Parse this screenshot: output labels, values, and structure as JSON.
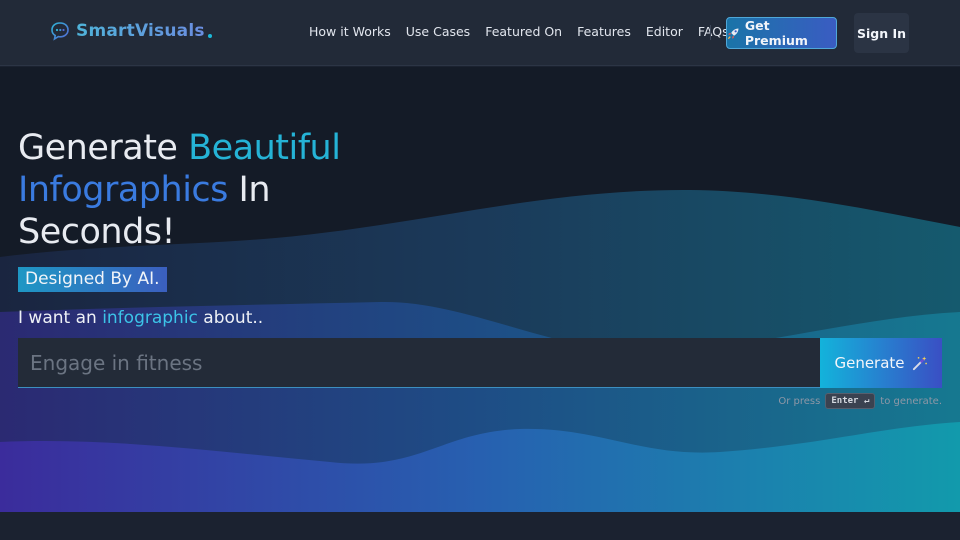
{
  "brand": {
    "name": "SmartVisuals"
  },
  "nav": {
    "links": [
      "How it Works",
      "Use Cases",
      "Featured On",
      "Features",
      "Editor",
      "FAQs"
    ],
    "premium_label": "Get Premium",
    "signin_label": "Sign In"
  },
  "hero": {
    "headline": {
      "part1": "Generate ",
      "part2": "Beautiful",
      "part3": "Infographics",
      "part4": " In",
      "part5": "Seconds!"
    },
    "badge": "Designed By AI.",
    "prompt": {
      "before": "I want an ",
      "keyword": "infographic",
      "after": " about.."
    },
    "search": {
      "placeholder": "Engage in fitness",
      "value": ""
    },
    "generate_label": "Generate",
    "hint": {
      "before": "Or press",
      "key": "Enter ↵",
      "after": "to generate."
    }
  },
  "colors": {
    "accent_cyan": "#25b3d6",
    "accent_blue": "#3a7be0",
    "background": "#141b27"
  }
}
